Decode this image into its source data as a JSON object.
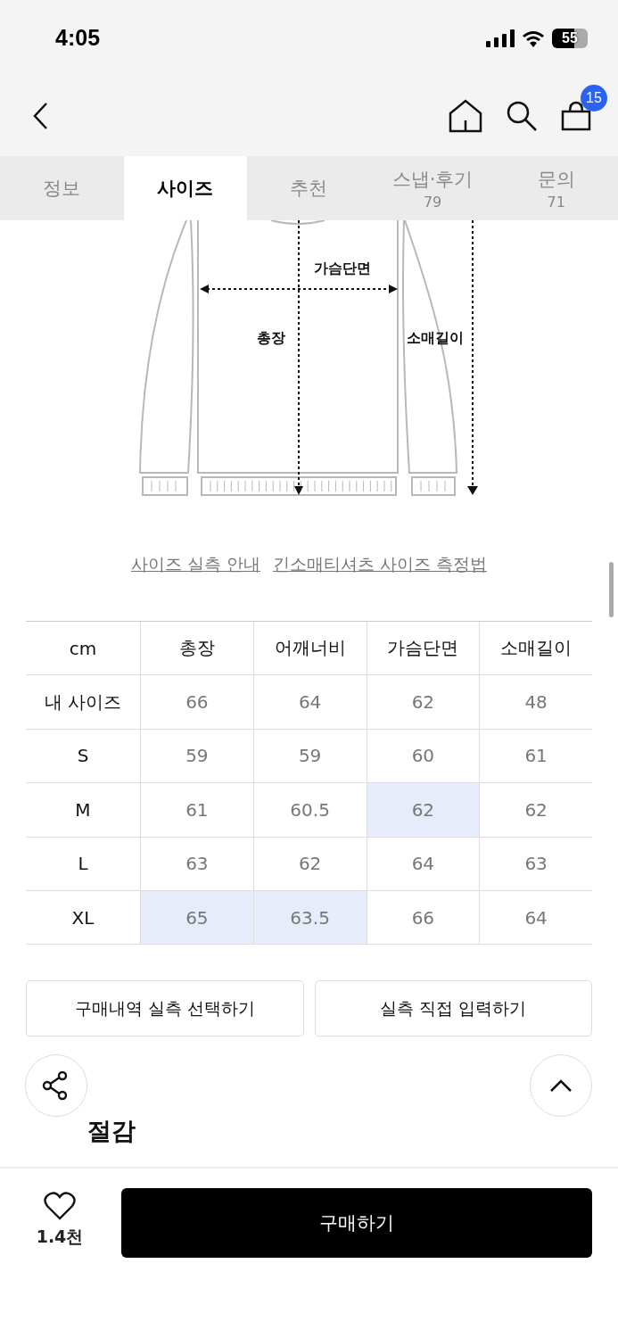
{
  "status_bar": {
    "time": "4:05",
    "battery": "55"
  },
  "nav": {
    "cart_count": "15"
  },
  "tabs": [
    {
      "label": "정보",
      "selected": false
    },
    {
      "label": "사이즈",
      "selected": true
    },
    {
      "label": "추천",
      "selected": false
    },
    {
      "label": "스냅·후기",
      "count": "79",
      "selected": false
    },
    {
      "label": "문의",
      "count": "71",
      "selected": false
    }
  ],
  "diagram": {
    "labels": {
      "chest": "가슴단면",
      "length": "총장",
      "sleeve": "소매길이"
    }
  },
  "links": [
    "사이즈 실측 안내",
    "긴소매티셔츠 사이즈 측정법"
  ],
  "size_table": {
    "columns": [
      "cm",
      "총장",
      "어깨너비",
      "가슴단면",
      "소매길이"
    ],
    "rows": [
      {
        "cells": [
          {
            "text": "내 사이즈",
            "highlighted": false
          },
          {
            "text": "66",
            "highlighted": false
          },
          {
            "text": "64",
            "highlighted": false
          },
          {
            "text": "62",
            "highlighted": false
          },
          {
            "text": "48",
            "highlighted": false
          }
        ]
      },
      {
        "cells": [
          {
            "text": "S",
            "highlighted": false
          },
          {
            "text": "59",
            "highlighted": false
          },
          {
            "text": "59",
            "highlighted": false
          },
          {
            "text": "60",
            "highlighted": false
          },
          {
            "text": "61",
            "highlighted": false
          }
        ]
      },
      {
        "cells": [
          {
            "text": "M",
            "highlighted": false
          },
          {
            "text": "61",
            "highlighted": false
          },
          {
            "text": "60.5",
            "highlighted": false
          },
          {
            "text": "62",
            "highlighted": true
          },
          {
            "text": "62",
            "highlighted": false
          }
        ]
      },
      {
        "cells": [
          {
            "text": "L",
            "highlighted": false
          },
          {
            "text": "63",
            "highlighted": false
          },
          {
            "text": "62",
            "highlighted": false
          },
          {
            "text": "64",
            "highlighted": false
          },
          {
            "text": "63",
            "highlighted": false
          }
        ]
      },
      {
        "cells": [
          {
            "text": "XL",
            "highlighted": false
          },
          {
            "text": "65",
            "highlighted": true
          },
          {
            "text": "63.5",
            "highlighted": true
          },
          {
            "text": "66",
            "highlighted": false
          },
          {
            "text": "64",
            "highlighted": false
          }
        ]
      }
    ]
  },
  "action_buttons": [
    "구매내역 실측 선택하기",
    "실측 직접 입력하기"
  ],
  "section_heading": "절감",
  "bottom_bar": {
    "like_count": "1.4천",
    "buy_button": "구매하기"
  }
}
